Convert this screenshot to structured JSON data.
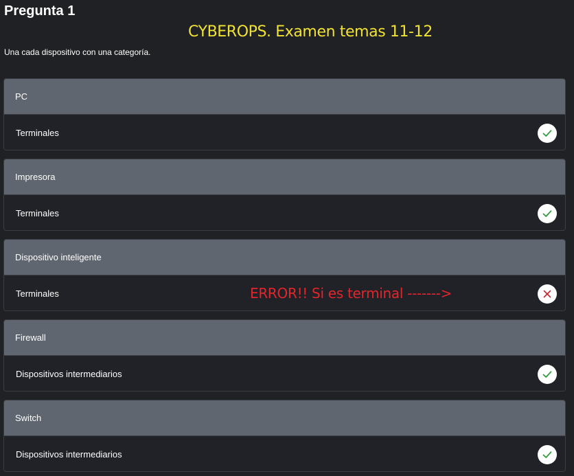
{
  "question": {
    "title": "Pregunta 1",
    "instructions": "Una cada dispositivo con una categoría."
  },
  "overlay": {
    "exam_title": "CYBEROPS. Examen temas 11-12",
    "error_note": "ERROR!! Si es terminal ------->"
  },
  "items": [
    {
      "device": "PC",
      "answer": "Terminales",
      "status": "correct"
    },
    {
      "device": "Impresora",
      "answer": "Terminales",
      "status": "correct"
    },
    {
      "device": "Dispositivo inteligente",
      "answer": "Terminales",
      "status": "incorrect"
    },
    {
      "device": "Firewall",
      "answer": "Dispositivos intermediarios",
      "status": "correct"
    },
    {
      "device": "Switch",
      "answer": "Dispositivos intermediarios",
      "status": "correct"
    }
  ],
  "colors": {
    "correct": "#2e9a3a",
    "incorrect": "#c8232c",
    "overlay_title": "#f2e233",
    "overlay_error": "#e2262b"
  },
  "icons": {
    "correct": "check-icon",
    "incorrect": "x-icon"
  }
}
